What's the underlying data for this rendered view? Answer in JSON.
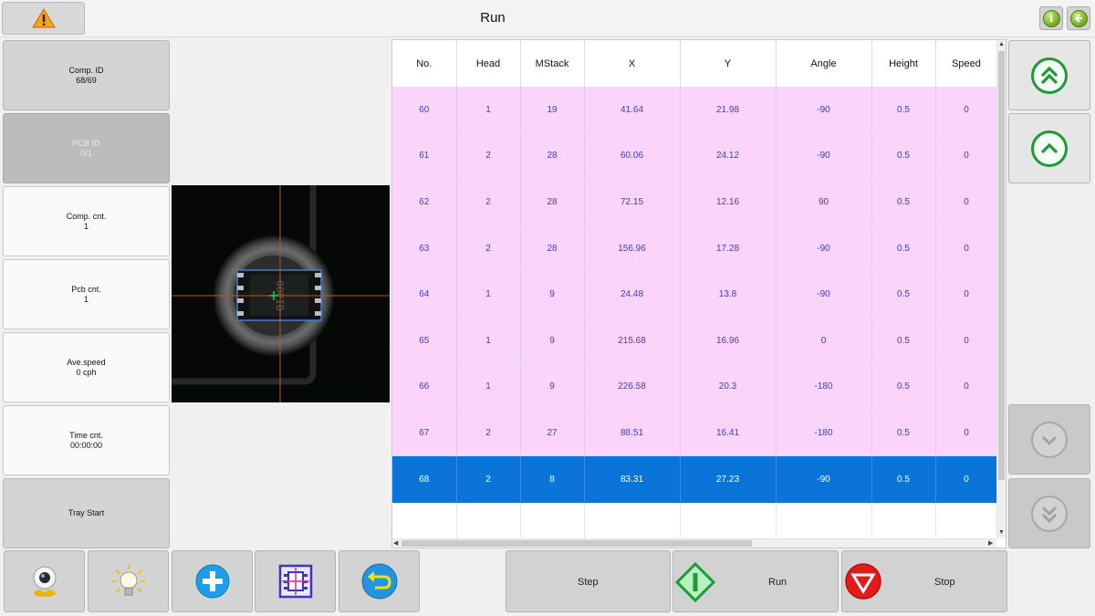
{
  "header": {
    "title": "Run",
    "warning_icon": "warning-icon",
    "info_icon": "info-icon",
    "back_icon": "back-arrow-icon",
    "info_glyph": "i"
  },
  "left_panel": {
    "comp_id": {
      "label": "Comp. ID",
      "value": "68/69"
    },
    "pcb_id": {
      "label": "PCB ID",
      "value": "0/1"
    },
    "comp_cnt": {
      "label": "Comp. cnt.",
      "value": "1"
    },
    "pcb_cnt": {
      "label": "Pcb cnt.",
      "value": "1"
    },
    "ave_speed": {
      "label": "Ave.speed",
      "value": "0 cph"
    },
    "time_cnt": {
      "label": "Time cnt.",
      "value": "00:00:00"
    },
    "tray_start": "Tray Start"
  },
  "camera": {
    "chip_marking": "00PIB"
  },
  "table": {
    "columns": [
      "No.",
      "Head",
      "MStack",
      "X",
      "Y",
      "Angle",
      "Height",
      "Speed"
    ],
    "rows": [
      [
        "60",
        "1",
        "19",
        "41.64",
        "21.98",
        "-90",
        "0.5",
        "0"
      ],
      [
        "61",
        "2",
        "28",
        "60.06",
        "24.12",
        "-90",
        "0.5",
        "0"
      ],
      [
        "62",
        "2",
        "28",
        "72.15",
        "12.16",
        "90",
        "0.5",
        "0"
      ],
      [
        "63",
        "2",
        "28",
        "156.96",
        "17.28",
        "-90",
        "0.5",
        "0"
      ],
      [
        "64",
        "1",
        "9",
        "24.48",
        "13.8",
        "-90",
        "0.5",
        "0"
      ],
      [
        "65",
        "1",
        "9",
        "215.68",
        "16.96",
        "0",
        "0.5",
        "0"
      ],
      [
        "66",
        "1",
        "9",
        "226.58",
        "20.3",
        "-180",
        "0.5",
        "0"
      ],
      [
        "67",
        "2",
        "27",
        "88.51",
        "16.41",
        "-180",
        "0.5",
        "0"
      ],
      [
        "68",
        "2",
        "8",
        "83.31",
        "27.23",
        "-90",
        "0.5",
        "0"
      ]
    ],
    "selected_row": "68"
  },
  "scrollbar": {
    "up_glyph": "▲",
    "down_glyph": "▼",
    "left_glyph": "◀",
    "right_glyph": "▶"
  },
  "nav_buttons": {
    "page_up_icon": "double-chevron-up-icon",
    "up_icon": "chevron-up-icon",
    "down_icon": "chevron-down-icon",
    "page_down_icon": "double-chevron-down-icon"
  },
  "toolbar": {
    "camera_icon": "camera-icon",
    "light_icon": "light-bulb-icon",
    "add_icon": "add-icon",
    "calibrate_icon": "calibrate-icon",
    "undo_icon": "undo-icon",
    "step_label": "Step",
    "run_label": "Run",
    "stop_label": "Stop"
  },
  "colors": {
    "row_pink": "#fad4fa",
    "row_selected": "#0a74d8",
    "row_text": "#3c40c8",
    "run_green": "#1e9a38",
    "stop_red": "#e21b1b"
  }
}
